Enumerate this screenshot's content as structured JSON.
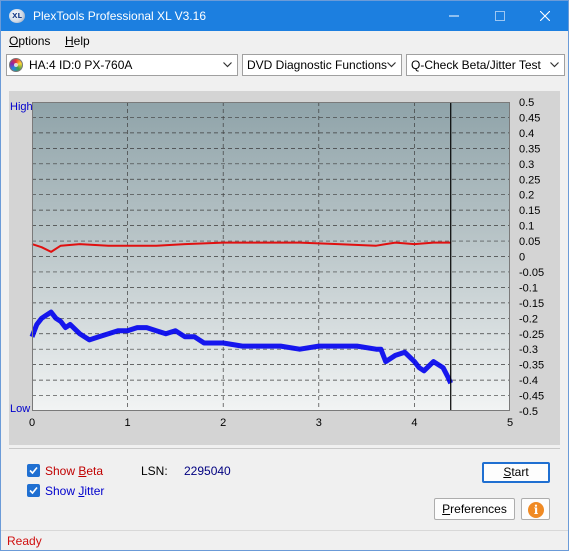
{
  "window": {
    "title": "PlexTools Professional XL V3.16",
    "app_icon_text": "XL"
  },
  "menu": {
    "options": {
      "first": "O",
      "rest": "ptions"
    },
    "help": {
      "first": "H",
      "rest": "elp"
    }
  },
  "toolbar": {
    "drive": "HA:4 ID:0  PX-760A",
    "function": "DVD Diagnostic Functions",
    "test": "Q-Check Beta/Jitter Test"
  },
  "controls": {
    "show_beta": {
      "before": "Show ",
      "underlined": "B",
      "after": "eta",
      "checked": true,
      "color": "#c00000"
    },
    "show_jitter": {
      "before": "Show ",
      "underlined": "J",
      "after": "itter",
      "checked": true,
      "color": "#0000cc"
    },
    "lsn_label": "LSN:",
    "lsn_value": "2295040",
    "start": {
      "before": "",
      "underlined": "S",
      "after": "tart"
    },
    "preferences": {
      "before": "",
      "underlined": "P",
      "after": "references"
    },
    "info_icon_text": "i"
  },
  "status": {
    "text": "Ready"
  },
  "colors": {
    "titlebar": "#1c7fe0",
    "beta_series": "#e01010",
    "jitter_series": "#0000ee",
    "accent": "#1f6fd1"
  },
  "chart_data": {
    "type": "line",
    "left_axis": {
      "top_label": "High",
      "bottom_label": "Low"
    },
    "x_ticks": [
      "0",
      "1",
      "2",
      "3",
      "4",
      "5"
    ],
    "y_ticks": [
      "0.5",
      "0.45",
      "0.4",
      "0.35",
      "0.3",
      "0.25",
      "0.2",
      "0.15",
      "0.1",
      "0.05",
      "0",
      "-0.05",
      "-0.1",
      "-0.15",
      "-0.2",
      "-0.25",
      "-0.3",
      "-0.35",
      "-0.4",
      "-0.45",
      "-0.5"
    ],
    "xlim": [
      0,
      5
    ],
    "ylim": [
      -0.5,
      0.5
    ],
    "grid": true,
    "end_marker_x": 4.38,
    "series": [
      {
        "color": "#e01010",
        "x": [
          0,
          0.1,
          0.2,
          0.3,
          0.5,
          0.8,
          1.0,
          1.3,
          1.6,
          2.0,
          2.4,
          2.8,
          3.2,
          3.6,
          3.8,
          4.0,
          4.2,
          4.38
        ],
        "y": [
          0.04,
          0.03,
          0.015,
          0.035,
          0.04,
          0.035,
          0.035,
          0.035,
          0.04,
          0.045,
          0.045,
          0.045,
          0.04,
          0.035,
          0.045,
          0.04,
          0.045,
          0.045
        ]
      },
      {
        "color": "#0000ee",
        "x": [
          0,
          0.05,
          0.1,
          0.15,
          0.2,
          0.25,
          0.3,
          0.35,
          0.4,
          0.5,
          0.6,
          0.7,
          0.8,
          0.9,
          1.0,
          1.1,
          1.2,
          1.3,
          1.4,
          1.5,
          1.6,
          1.7,
          1.8,
          1.9,
          2.0,
          2.2,
          2.4,
          2.6,
          2.8,
          3.0,
          3.2,
          3.4,
          3.6,
          3.65,
          3.7,
          3.8,
          3.9,
          4.0,
          4.05,
          4.1,
          4.2,
          4.3,
          4.35,
          4.38
        ],
        "y": [
          -0.26,
          -0.22,
          -0.2,
          -0.19,
          -0.18,
          -0.2,
          -0.21,
          -0.23,
          -0.22,
          -0.25,
          -0.27,
          -0.26,
          -0.25,
          -0.24,
          -0.24,
          -0.23,
          -0.23,
          -0.24,
          -0.25,
          -0.24,
          -0.26,
          -0.26,
          -0.28,
          -0.28,
          -0.28,
          -0.29,
          -0.29,
          -0.29,
          -0.3,
          -0.29,
          -0.29,
          -0.29,
          -0.3,
          -0.3,
          -0.34,
          -0.32,
          -0.31,
          -0.34,
          -0.36,
          -0.37,
          -0.34,
          -0.36,
          -0.39,
          -0.41
        ]
      }
    ]
  }
}
